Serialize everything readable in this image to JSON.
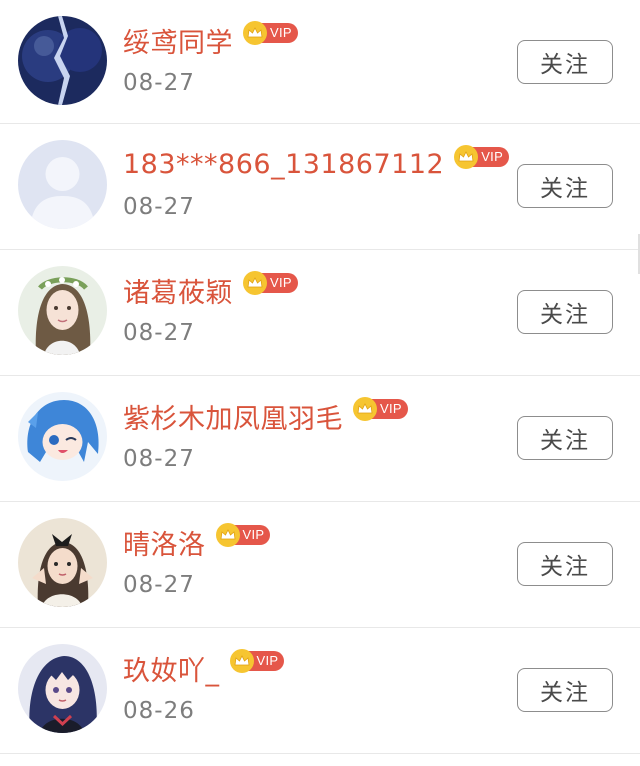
{
  "vip_label": "VIP",
  "follow_label": "关注",
  "colors": {
    "name": "#d9543b",
    "vip_badge": "#e5574a",
    "crown": "#f6c531",
    "date": "#7d7d7d",
    "divider": "#e8e8e8"
  },
  "users": [
    {
      "name": "绥鸢同学",
      "date": "08-27",
      "vip": true,
      "avatar": "dark-blue-figure"
    },
    {
      "name": "183***866_131867112",
      "date": "08-27",
      "vip": true,
      "avatar": "default-silhouette"
    },
    {
      "name": "诸葛莜颖",
      "date": "08-27",
      "vip": true,
      "avatar": "girl-with-flower-crown"
    },
    {
      "name": "紫杉木加凤凰羽毛",
      "date": "08-27",
      "vip": true,
      "avatar": "anime-blue-hair"
    },
    {
      "name": "晴洛洛",
      "date": "08-27",
      "vip": true,
      "avatar": "girl-with-bow"
    },
    {
      "name": "玖奻吖_",
      "date": "08-26",
      "vip": true,
      "avatar": "anime-dark-hair"
    }
  ]
}
